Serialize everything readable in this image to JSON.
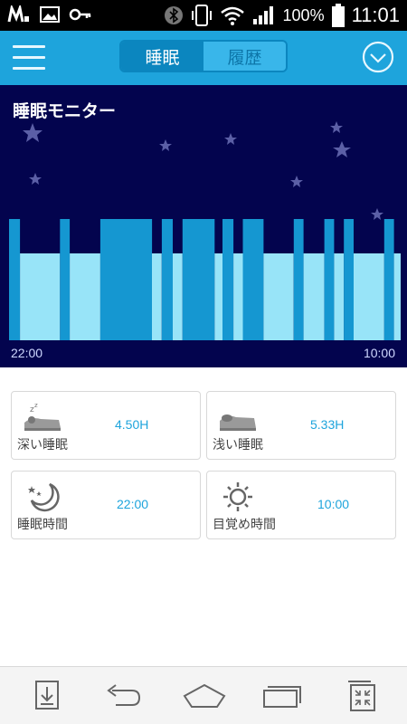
{
  "status_bar": {
    "battery_text": "100%",
    "time": "11:01",
    "icons": [
      "lg-icon",
      "image-icon",
      "key-icon",
      "bluetooth-icon",
      "vibrate-icon",
      "wifi-icon",
      "signal-icon",
      "battery-icon"
    ]
  },
  "header": {
    "tabs": [
      {
        "label": "睡眠",
        "active": true
      },
      {
        "label": "履歴",
        "active": false
      }
    ],
    "menu_icon": "hamburger-menu-icon",
    "dropdown_icon": "chevron-down-circle-icon"
  },
  "monitor": {
    "title": "睡眠モニター",
    "start_time": "22:00",
    "end_time": "10:00",
    "colors": {
      "background": "#03044e",
      "deep": "#1597d1",
      "light": "#98e4f8"
    }
  },
  "chart_data": {
    "type": "bar",
    "x_range": [
      "22:00",
      "10:00"
    ],
    "series": [
      {
        "name": "",
        "values": []
      }
    ],
    "segments_fraction": [
      {
        "start": 0.0,
        "end": 0.028,
        "stage": "deep"
      },
      {
        "start": 0.028,
        "end": 0.13,
        "stage": "light"
      },
      {
        "start": 0.13,
        "end": 0.155,
        "stage": "deep"
      },
      {
        "start": 0.155,
        "end": 0.233,
        "stage": "light"
      },
      {
        "start": 0.233,
        "end": 0.365,
        "stage": "deep"
      },
      {
        "start": 0.365,
        "end": 0.39,
        "stage": "light"
      },
      {
        "start": 0.39,
        "end": 0.418,
        "stage": "deep"
      },
      {
        "start": 0.418,
        "end": 0.443,
        "stage": "light"
      },
      {
        "start": 0.443,
        "end": 0.525,
        "stage": "deep"
      },
      {
        "start": 0.525,
        "end": 0.545,
        "stage": "light"
      },
      {
        "start": 0.545,
        "end": 0.573,
        "stage": "deep"
      },
      {
        "start": 0.573,
        "end": 0.597,
        "stage": "light"
      },
      {
        "start": 0.597,
        "end": 0.65,
        "stage": "deep"
      },
      {
        "start": 0.65,
        "end": 0.727,
        "stage": "light"
      },
      {
        "start": 0.727,
        "end": 0.752,
        "stage": "deep"
      },
      {
        "start": 0.752,
        "end": 0.805,
        "stage": "light"
      },
      {
        "start": 0.805,
        "end": 0.83,
        "stage": "deep"
      },
      {
        "start": 0.83,
        "end": 0.855,
        "stage": "light"
      },
      {
        "start": 0.855,
        "end": 0.88,
        "stage": "deep"
      },
      {
        "start": 0.88,
        "end": 0.958,
        "stage": "light"
      },
      {
        "start": 0.958,
        "end": 0.983,
        "stage": "deep"
      },
      {
        "start": 0.983,
        "end": 1.0,
        "stage": "light"
      }
    ]
  },
  "stats": [
    {
      "label": "深い睡眠",
      "value": "4.50H",
      "icon": "deep-sleep-icon"
    },
    {
      "label": "浅い睡眠",
      "value": "5.33H",
      "icon": "light-sleep-icon"
    },
    {
      "label": "睡眠時間",
      "value": "22:00",
      "icon": "moon-stars-icon"
    },
    {
      "label": "目覚め時間",
      "value": "10:00",
      "icon": "sun-icon"
    }
  ],
  "navbar": {
    "icons": [
      "download-icon",
      "back-icon",
      "home-icon",
      "recents-icon",
      "screenshot-icon"
    ]
  }
}
